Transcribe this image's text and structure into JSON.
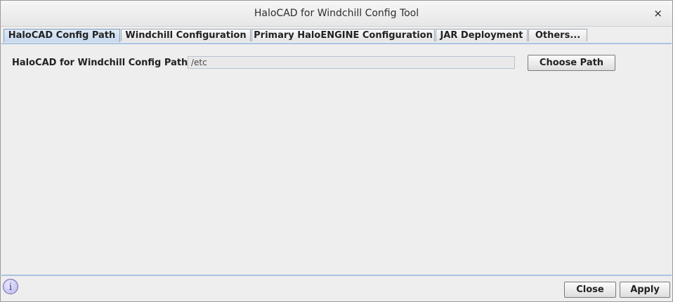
{
  "window": {
    "title": "HaloCAD for Windchill Config Tool",
    "close_glyph": "×"
  },
  "tabs": [
    {
      "label": "HaloCAD Config Path",
      "active": true
    },
    {
      "label": "Windchill Configuration",
      "active": false
    },
    {
      "label": "Primary HaloENGINE Configuration",
      "active": false
    },
    {
      "label": "JAR Deployment",
      "active": false
    },
    {
      "label": "Others...",
      "active": false
    }
  ],
  "config_path": {
    "label": "HaloCAD for Windchill Config Path",
    "value": "/etc",
    "choose_button": "Choose Path"
  },
  "footer": {
    "info_icon": "i",
    "close_button": "Close",
    "apply_button": "Apply"
  },
  "colors": {
    "active_tab": "#c7d8ee",
    "panel_border": "#a9c4e2",
    "info_icon": "#b8b5e6"
  },
  "icons": {
    "window_close": "close-icon",
    "info": "info-icon"
  }
}
